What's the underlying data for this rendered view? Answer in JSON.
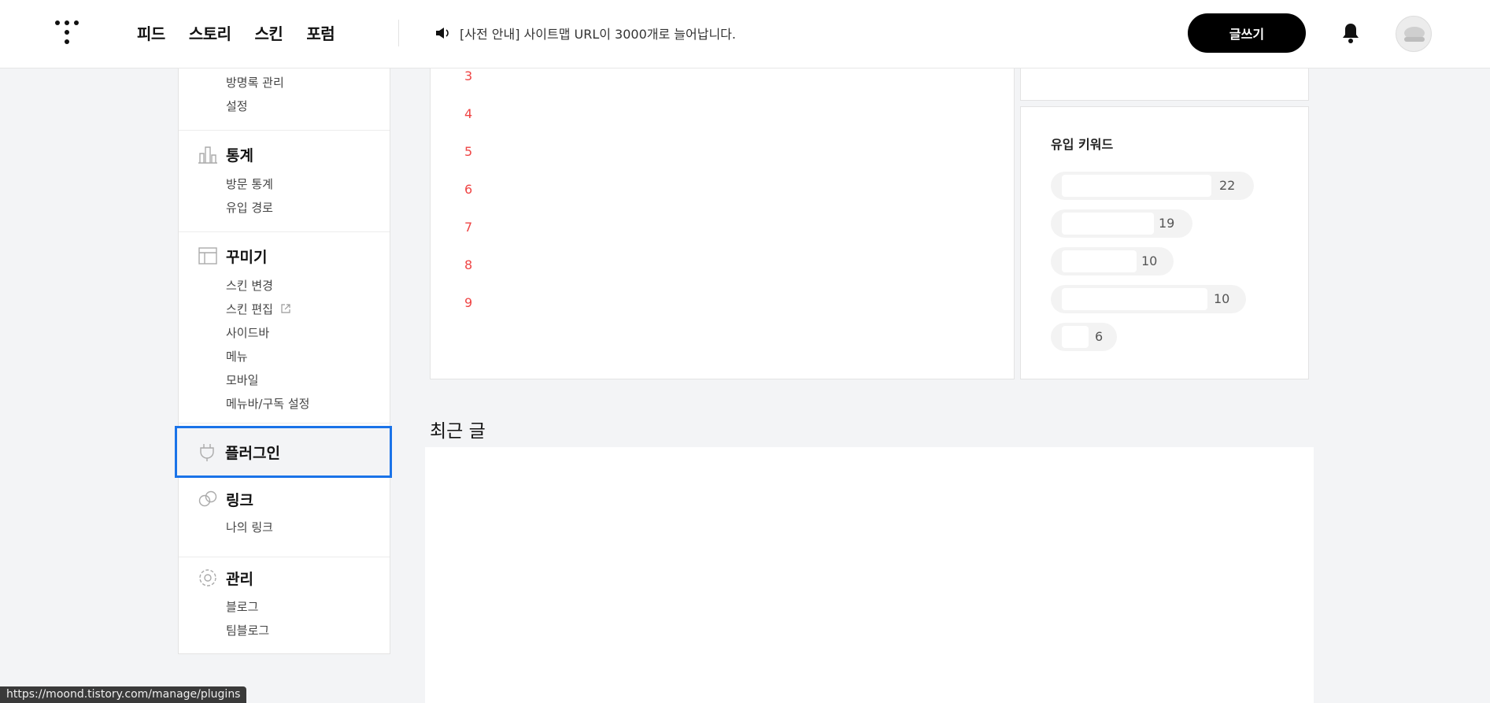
{
  "header": {
    "nav": [
      "피드",
      "스토리",
      "스킨",
      "포럼"
    ],
    "notice": "[사전 안내] 사이트맵 URL이 3000개로 늘어납니다.",
    "write_button": "글쓰기"
  },
  "sidebar": {
    "top_items": [
      "방명록 관리",
      "설정"
    ],
    "stats": {
      "title": "통계",
      "items": [
        "방문 통계",
        "유입 경로"
      ]
    },
    "decorate": {
      "title": "꾸미기",
      "items": [
        "스킨 변경",
        "스킨 편집",
        "사이드바",
        "메뉴",
        "모바일",
        "메뉴바/구독 설정"
      ]
    },
    "plugin": {
      "title": "플러그인"
    },
    "link": {
      "title": "링크",
      "items": [
        "나의 링크"
      ]
    },
    "manage": {
      "title": "관리",
      "items": [
        "블로그",
        "팀블로그"
      ]
    }
  },
  "ranks": [
    "3",
    "4",
    "5",
    "6",
    "7",
    "8",
    "9"
  ],
  "keywords": {
    "title": "유입 키워드",
    "counts": [
      "22",
      "19",
      "10",
      "10",
      "6"
    ]
  },
  "recent": {
    "title": "최근 글"
  },
  "status_url": "https://moond.tistory.com/manage/plugins",
  "colors": {
    "accent": "#1a73e8",
    "rank": "#ef4444"
  }
}
